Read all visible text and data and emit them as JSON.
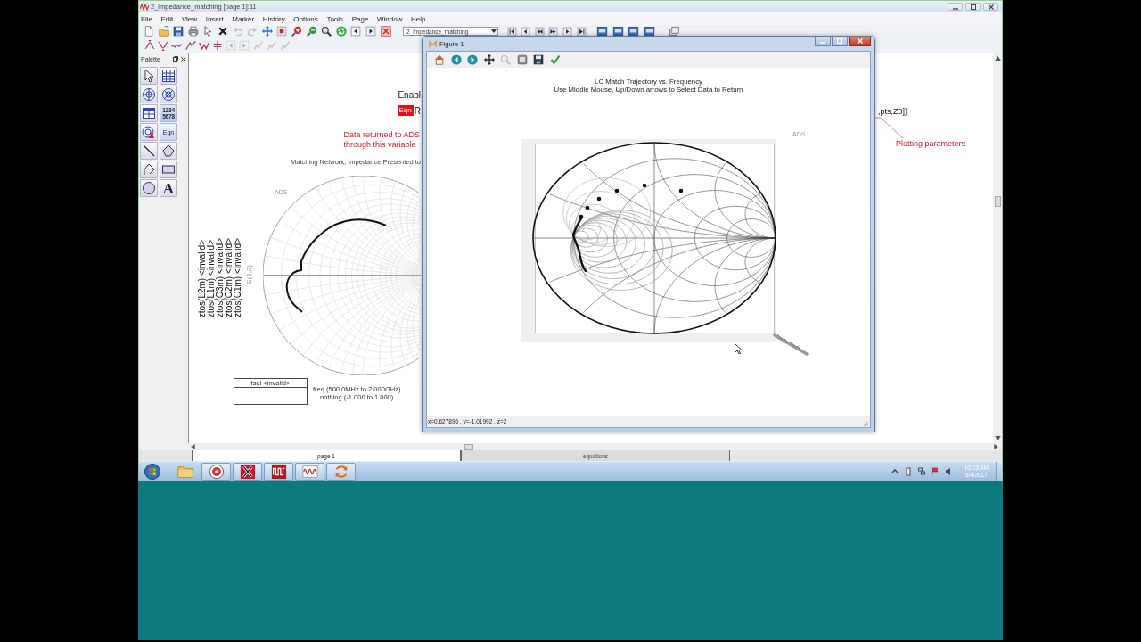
{
  "window": {
    "title": "2_impedance_matching [page 1]:11"
  },
  "menu": [
    "File",
    "Edit",
    "View",
    "Insert",
    "Marker",
    "History",
    "Options",
    "Tools",
    "Page",
    "Window",
    "Help"
  ],
  "toolbar": [
    {
      "kind": "new",
      "disabled": false
    },
    {
      "kind": "open",
      "disabled": false
    },
    {
      "kind": "save",
      "disabled": false
    },
    {
      "kind": "print",
      "disabled": false
    },
    {
      "kind": "pointer",
      "disabled": false
    },
    {
      "kind": "delete",
      "disabled": false
    },
    {
      "kind": "undo",
      "disabled": true
    },
    {
      "kind": "redo",
      "disabled": true
    },
    {
      "kind": "move",
      "disabled": false
    },
    {
      "kind": "zoom_box",
      "disabled": false
    },
    {
      "kind": "zoom_in",
      "disabled": false
    },
    {
      "kind": "zoom_out",
      "disabled": false
    },
    {
      "kind": "magnifier",
      "disabled": false
    },
    {
      "kind": "refresh",
      "disabled": false
    },
    {
      "kind": "prev",
      "disabled": false
    },
    {
      "kind": "next",
      "disabled": false
    },
    {
      "kind": "stop",
      "disabled": false
    }
  ],
  "page_select": {
    "value": "2_impedance_matching"
  },
  "toolbar_2": [
    {
      "kind": "marker_peak",
      "disabled": false
    },
    {
      "kind": "marker_valley",
      "disabled": false
    },
    {
      "kind": "marker_delta",
      "disabled": false
    },
    {
      "kind": "marker_line",
      "disabled": false
    },
    {
      "kind": "marker_v",
      "disabled": false
    },
    {
      "kind": "spread",
      "disabled": false
    },
    {
      "kind": "prev",
      "disabled": true
    },
    {
      "kind": "next",
      "disabled": true
    },
    {
      "kind": "trace",
      "disabled": true
    },
    {
      "kind": "trace",
      "disabled": true
    },
    {
      "kind": "trace",
      "disabled": true
    }
  ],
  "palette": {
    "title": "Palette",
    "items": [
      {
        "kind": "pointer"
      },
      {
        "kind": "table"
      },
      {
        "kind": "smith"
      },
      {
        "kind": "polar"
      },
      {
        "kind": "list"
      },
      {
        "kind": "numbers",
        "label": "1234 5678"
      },
      {
        "kind": "trace"
      },
      {
        "kind": "equation",
        "label": "Eqn"
      },
      {
        "kind": "line"
      },
      {
        "kind": "polygon"
      },
      {
        "kind": "polyline"
      },
      {
        "kind": "rectangle"
      },
      {
        "kind": "ellipse"
      },
      {
        "kind": "text",
        "label": "A"
      }
    ]
  },
  "canvas": {
    "enable_text": "Enabl",
    "equation": {
      "badge": "Eqn",
      "text": "R",
      "tail": ",pts,Z0])"
    },
    "note": [
      "Data returned to ADS",
      "through this variable"
    ],
    "plot_title": "Matching Network, Impedance Presented to",
    "plot_label": "ADS",
    "legend": [
      "ztos(L2m) <invalid>",
      "ztos(L1m) <invalid>",
      "ztos(C3m) <invalid>",
      "ztos(C2m) <invalid>",
      "ztos(C1m) <invalid>"
    ],
    "axis_label": "S(2,2)",
    "slider": {
      "label": "fsel <invalid>"
    },
    "sweep": [
      "freq (500.0MHz to 2.000GHz)",
      "nothing (-1.000 to 1.000)"
    ],
    "annotation": "Plotting parameters"
  },
  "figure": {
    "title": "Figure 1",
    "toolbar": [
      {
        "kind": "home",
        "disabled": false
      },
      {
        "kind": "back",
        "disabled": false
      },
      {
        "kind": "forward",
        "disabled": false
      },
      {
        "kind": "pan",
        "disabled": false
      },
      {
        "kind": "zoom",
        "disabled": true
      },
      {
        "kind": "subplots",
        "disabled": false
      },
      {
        "kind": "save",
        "disabled": false
      },
      {
        "kind": "check",
        "disabled": false
      }
    ],
    "heading": [
      "LC Match Trajectory vs. Frequency",
      "Use Middle Mouse, Up/Down arrows to Select Data to Return"
    ],
    "plot_label": "ADS",
    "status": "x=0.627896 , y=-1.01992 , z=2"
  },
  "page_tabs": [
    {
      "label": "page 1",
      "selected": true
    },
    {
      "label": "equations",
      "selected": false
    }
  ],
  "taskbar": {
    "apps": [
      {
        "kind": "folder",
        "running": false
      },
      {
        "kind": "disc",
        "running": true
      },
      {
        "kind": "cross",
        "running": true
      },
      {
        "kind": "scope",
        "running": true
      },
      {
        "kind": "wave",
        "running": true
      },
      {
        "kind": "swirl",
        "running": true
      }
    ],
    "time": "10:23 AM",
    "date": "5/4/2017"
  }
}
